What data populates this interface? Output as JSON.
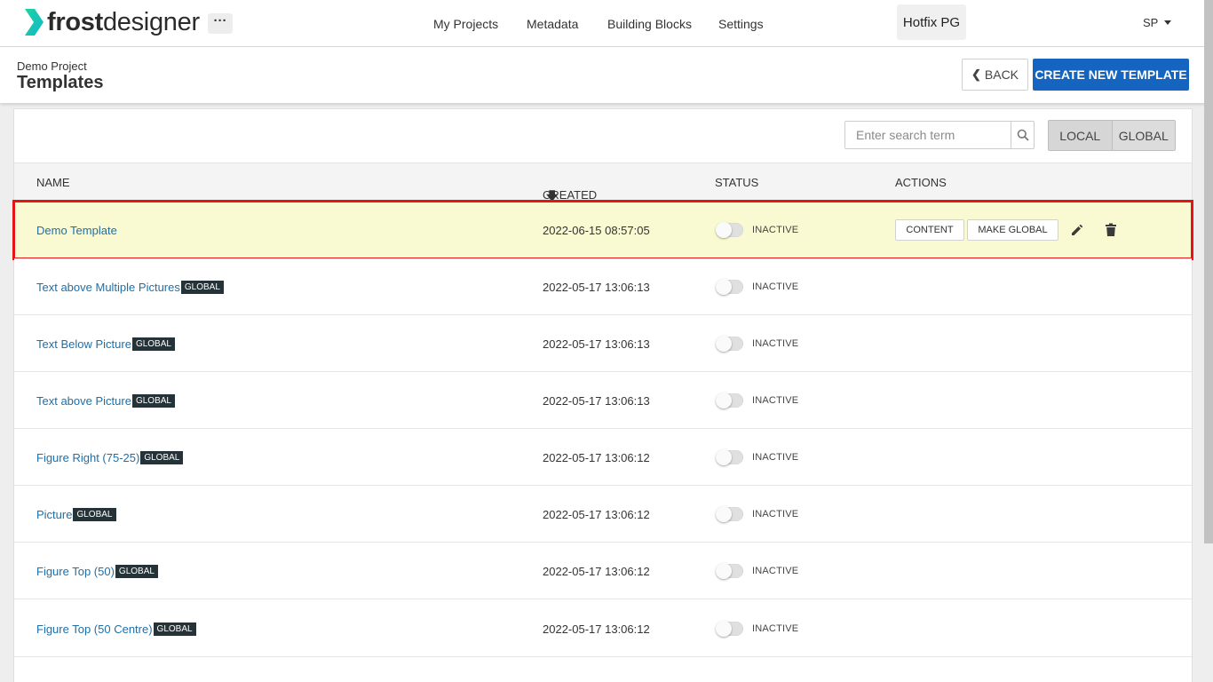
{
  "app": {
    "logo_bold": "frost",
    "logo_light": "designer",
    "more_label": "···"
  },
  "nav": {
    "items": [
      "My Projects",
      "Metadata",
      "Building Blocks",
      "Settings"
    ]
  },
  "current_project": "Hotfix PG",
  "user": {
    "initials": "SP"
  },
  "header": {
    "breadcrumb": "Demo Project",
    "title": "Templates",
    "back_label": "BACK",
    "create_label": "CREATE NEW TEMPLATE"
  },
  "search": {
    "placeholder": "Enter search term",
    "value": ""
  },
  "scope": {
    "options": [
      "LOCAL",
      "GLOBAL"
    ]
  },
  "table": {
    "columns": {
      "name": "NAME",
      "created_at": "CREATED AT",
      "status": "STATUS",
      "actions": "ACTIONS"
    },
    "actions": {
      "content": "CONTENT",
      "make_global": "MAKE GLOBAL"
    },
    "rows": [
      {
        "name": "Demo Template",
        "badge": "",
        "created_at": "2022-06-15 08:57:05",
        "status": "INACTIVE",
        "highlighted": true
      },
      {
        "name": "Text above Multiple Pictures",
        "badge": "GLOBAL",
        "created_at": "2022-05-17 13:06:13",
        "status": "INACTIVE"
      },
      {
        "name": "Text Below Picture",
        "badge": "GLOBAL",
        "created_at": "2022-05-17 13:06:13",
        "status": "INACTIVE"
      },
      {
        "name": "Text above Picture",
        "badge": "GLOBAL",
        "created_at": "2022-05-17 13:06:13",
        "status": "INACTIVE"
      },
      {
        "name": "Figure Right (75-25)",
        "badge": "GLOBAL",
        "created_at": "2022-05-17 13:06:12",
        "status": "INACTIVE"
      },
      {
        "name": "Picture",
        "badge": "GLOBAL",
        "created_at": "2022-05-17 13:06:12",
        "status": "INACTIVE"
      },
      {
        "name": "Figure Top (50)",
        "badge": "GLOBAL",
        "created_at": "2022-05-17 13:06:12",
        "status": "INACTIVE"
      },
      {
        "name": "Figure Top (50 Centre)",
        "badge": "GLOBAL",
        "created_at": "2022-05-17 13:06:12",
        "status": "INACTIVE"
      }
    ]
  },
  "colors": {
    "accent": "#1565c0",
    "logo_teal": "#1bd3a0",
    "highlight_row": "#fafad2",
    "highlight_border": "#e41515",
    "badge": "#253238",
    "link": "#1e6fa8"
  },
  "icons": {
    "search": "search-icon",
    "edit": "pencil-icon",
    "delete": "trash-icon",
    "back": "chevron-left-icon",
    "sort": "arrow-down-icon",
    "user_menu": "caret-down-icon"
  }
}
